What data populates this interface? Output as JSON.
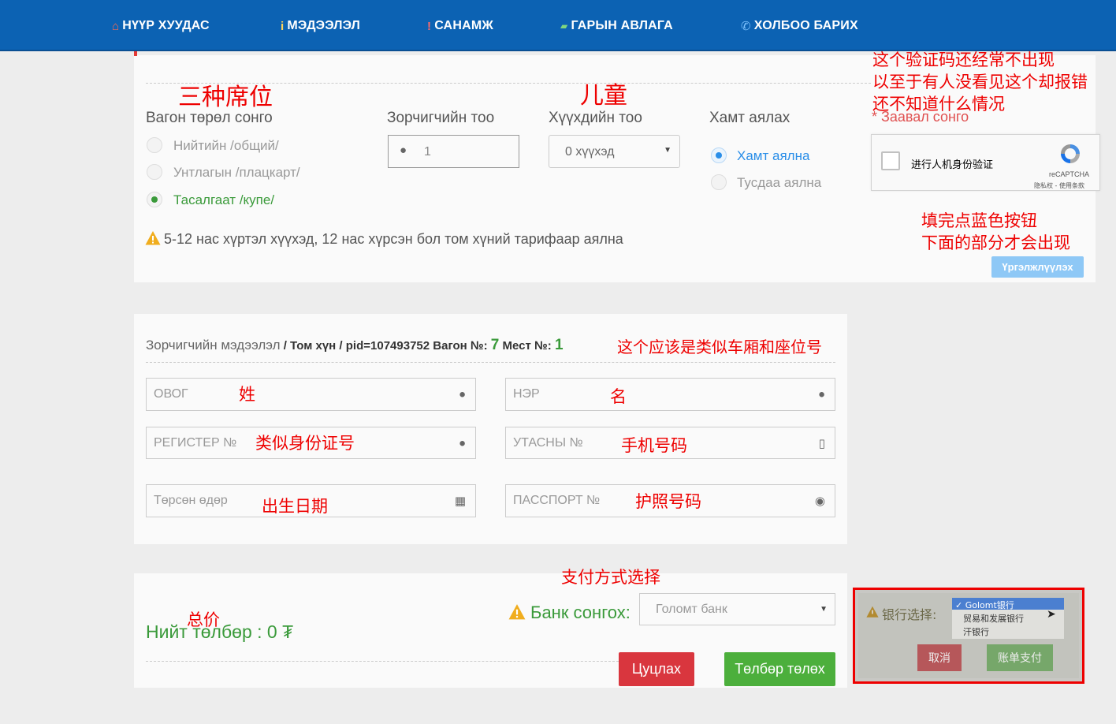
{
  "nav": {
    "items": [
      {
        "icon": "home-icon",
        "glyph": "⌂",
        "label": "НҮҮР ХУУДАС"
      },
      {
        "icon": "info-icon",
        "glyph": "i",
        "label": "МЭДЭЭЛЭЛ"
      },
      {
        "icon": "exclamation-icon",
        "glyph": "!",
        "label": "САНАМЖ"
      },
      {
        "icon": "book-icon",
        "glyph": "▰",
        "label": "ГАРЫН АВЛАГА"
      },
      {
        "icon": "phone-icon",
        "glyph": "✆",
        "label": "ХОЛБОО БАРИХ"
      }
    ]
  },
  "booking": {
    "wagon_type_label": "Вагон төрөл сонго",
    "wagon_types": [
      "Нийтийн /общий/",
      "Унтлагын /плацкарт/",
      "Тасалгаат /купе/"
    ],
    "wagon_selected_index": 2,
    "passenger_count_label": "Зорчигчийн тоо",
    "passenger_count_value": "1",
    "child_count_label": "Хүүхдийн тоо",
    "child_count_value": "0 хүүхэд",
    "together_label": "Хамт аялах",
    "together_options": [
      "Хамт аялна",
      "Тусдаа аялна"
    ],
    "together_selected_index": 0,
    "required_note": "* Заавал сонго",
    "captcha_label": "进行人机身份验证",
    "captcha_brand": "reCAPTCHA",
    "captcha_links": "隐私权 - 使用条款",
    "warning": "5-12 нас хүртэл хүүхэд, 12 нас хүрсэн бол том хүний тарифаар аялна",
    "continue_button": "Үргэлжлүүлэх"
  },
  "passenger": {
    "title": "Зорчигчийн мэдээлэл",
    "sep1": " / ",
    "type": "Том хүн",
    "sep2": " / ",
    "pid": "pid=107493752",
    "wagon_label": "Вагон №:",
    "wagon_no": "7",
    "seat_label": "Мест №:",
    "seat_no": "1",
    "fields": {
      "surname": "ОВОГ",
      "name": "НЭР",
      "register": "РЕГИСТЕР №",
      "phone": "УТАСНЫ №",
      "birthdate": "Төрсөн өдөр",
      "passport": "ПАССПОРТ №"
    }
  },
  "payment": {
    "total_label": "Нийт төлбөр : 0 ₮",
    "bank_label": "Банк сонгох:",
    "bank_value": "Голомт банк",
    "cancel_button": "Цуцлах",
    "pay_button": "Төлбөр төлөх"
  },
  "inset": {
    "label": "银行选择:",
    "options": [
      "✓ Golomt银行",
      "贸易和发展银行",
      "汗银行"
    ],
    "cancel": "取消",
    "pay": "账单支付"
  },
  "annotations": {
    "captcha_note": [
      "这个验证码还经常不出现",
      "以至于有人没看见这个却报错",
      "还不知道什么情况"
    ],
    "three_seats": "三种席位",
    "children": "儿童",
    "blue_button": [
      "填完点蓝色按钮",
      "下面的部分才会出现"
    ],
    "seat_number": "这个应该是类似车厢和座位号",
    "surname": "姓",
    "name": "名",
    "id_number": "类似身份证号",
    "phone": "手机号码",
    "birthdate": "出生日期",
    "passport": "护照号码",
    "payment_method": "支付方式选择",
    "total": "总价"
  },
  "colors": {
    "nav": "#0c62b3",
    "green": "#3a9a3a",
    "red_btn": "#d9363e",
    "green_btn": "#4caf3c",
    "annotation": "#e00000"
  }
}
